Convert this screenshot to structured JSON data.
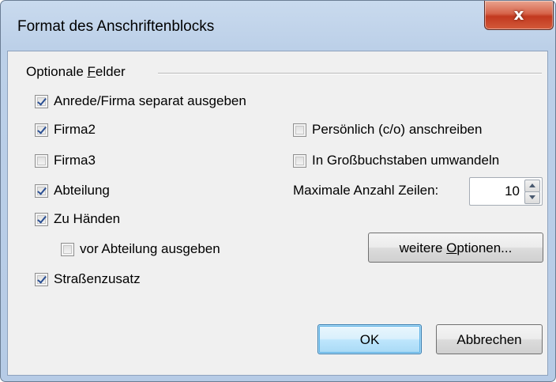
{
  "dialog": {
    "title": "Format des Anschriftenblocks",
    "close_symbol": "x"
  },
  "group": {
    "label_pre": "Optionale ",
    "label_mnemonic": "F",
    "label_post": "elder"
  },
  "checkboxes": {
    "anrede": {
      "label": "Anrede/Firma separat ausgeben",
      "checked": true
    },
    "firma2": {
      "label": "Firma2",
      "checked": true
    },
    "firma3": {
      "label": "Firma3",
      "checked": false
    },
    "abteilung": {
      "label": "Abteilung",
      "checked": true
    },
    "zu_haenden": {
      "label": "Zu Händen",
      "checked": true
    },
    "vor_abteilung": {
      "label": "vor Abteilung ausgeben",
      "checked": false
    },
    "strassenzusatz": {
      "label": "Straßenzusatz",
      "checked": true
    },
    "persoenlich": {
      "label": "Persönlich (c/o) anschreiben",
      "checked": false
    },
    "grossbuchstaben": {
      "label": "In Großbuchstaben umwandeln",
      "checked": false
    }
  },
  "max_lines": {
    "label": "Maximale Anzahl Zeilen:",
    "value": "10"
  },
  "buttons": {
    "more_options_pre": "weitere ",
    "more_options_mnemonic": "O",
    "more_options_post": "ptionen...",
    "ok": "OK",
    "cancel": "Abbrechen"
  },
  "icons": {
    "close": "close-icon",
    "spin_up": "arrow-up-icon",
    "spin_down": "arrow-down-icon"
  }
}
